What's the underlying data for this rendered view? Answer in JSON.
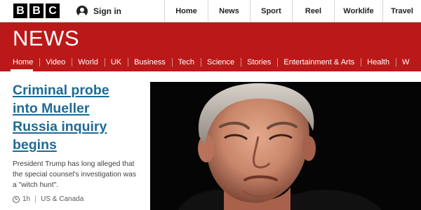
{
  "brand": {
    "logo_letters": [
      "B",
      "B",
      "C"
    ]
  },
  "account": {
    "signin_label": "Sign in",
    "icon": "user-icon"
  },
  "topnav": [
    {
      "label": "Home"
    },
    {
      "label": "News"
    },
    {
      "label": "Sport"
    },
    {
      "label": "Reel"
    },
    {
      "label": "Worklife"
    },
    {
      "label": "Travel"
    }
  ],
  "section": {
    "title": "NEWS",
    "color": "#bb1919"
  },
  "subnav": [
    {
      "label": "Home",
      "active": true
    },
    {
      "label": "Video"
    },
    {
      "label": "World"
    },
    {
      "label": "UK"
    },
    {
      "label": "Business"
    },
    {
      "label": "Tech"
    },
    {
      "label": "Science"
    },
    {
      "label": "Stories"
    },
    {
      "label": "Entertainment & Arts"
    },
    {
      "label": "Health"
    },
    {
      "label": "W"
    }
  ],
  "story": {
    "headline": "Criminal probe into Mueller Russia inquiry begins",
    "summary": "President Trump has long alleged that the special counsel's investigation was a \"witch hunt\".",
    "time": "1h",
    "time_icon": "clock-icon",
    "section": "US & Canada",
    "link_color": "#1d6b95"
  }
}
